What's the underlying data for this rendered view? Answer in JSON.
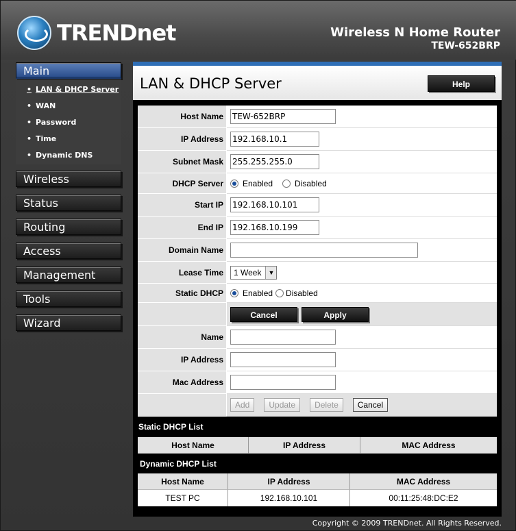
{
  "header": {
    "logo_text": "TRENDnet",
    "product_title": "Wireless N Home Router",
    "product_model": "TEW-652BRP"
  },
  "sidebar": {
    "main_label": "Main",
    "sub_items": [
      {
        "label": "LAN & DHCP Server"
      },
      {
        "label": "WAN"
      },
      {
        "label": "Password"
      },
      {
        "label": "Time"
      },
      {
        "label": "Dynamic DNS"
      }
    ],
    "items": [
      {
        "label": "Wireless"
      },
      {
        "label": "Status"
      },
      {
        "label": "Routing"
      },
      {
        "label": "Access"
      },
      {
        "label": "Management"
      },
      {
        "label": "Tools"
      },
      {
        "label": "Wizard"
      }
    ]
  },
  "main": {
    "title": "LAN & DHCP Server",
    "help_label": "Help",
    "fields": {
      "host_name": {
        "label": "Host Name",
        "value": "TEW-652BRP"
      },
      "ip_address": {
        "label": "IP Address",
        "value": "192.168.10.1"
      },
      "subnet_mask": {
        "label": "Subnet Mask",
        "value": "255.255.255.0"
      },
      "dhcp_server": {
        "label": "DHCP Server",
        "enabled_label": "Enabled",
        "disabled_label": "Disabled"
      },
      "start_ip": {
        "label": "Start IP",
        "value": "192.168.10.101"
      },
      "end_ip": {
        "label": "End IP",
        "value": "192.168.10.199"
      },
      "domain_name": {
        "label": "Domain Name",
        "value": ""
      },
      "lease_time": {
        "label": "Lease Time",
        "value": "1 Week"
      },
      "static_dhcp": {
        "label": "Static DHCP",
        "enabled_label": "Enabled",
        "disabled_label": "Disabled"
      }
    },
    "buttons": {
      "cancel": "Cancel",
      "apply": "Apply"
    },
    "static_entry": {
      "name_label": "Name",
      "ip_label": "IP Address",
      "mac_label": "Mac Address",
      "add": "Add",
      "update": "Update",
      "delete": "Delete",
      "cancel": "Cancel"
    },
    "static_list": {
      "title": "Static DHCP List",
      "columns": [
        "Host Name",
        "IP Address",
        "MAC Address"
      ]
    },
    "dynamic_list": {
      "title": "Dynamic DHCP List",
      "columns": [
        "Host Name",
        "IP Address",
        "MAC Address"
      ],
      "rows": [
        {
          "host": "TEST PC",
          "ip": "192.168.10.101",
          "mac": "00:11:25:48:DC:E2"
        }
      ]
    }
  },
  "footer": {
    "copyright": "Copyright © 2009 TRENDnet. All Rights Reserved."
  }
}
